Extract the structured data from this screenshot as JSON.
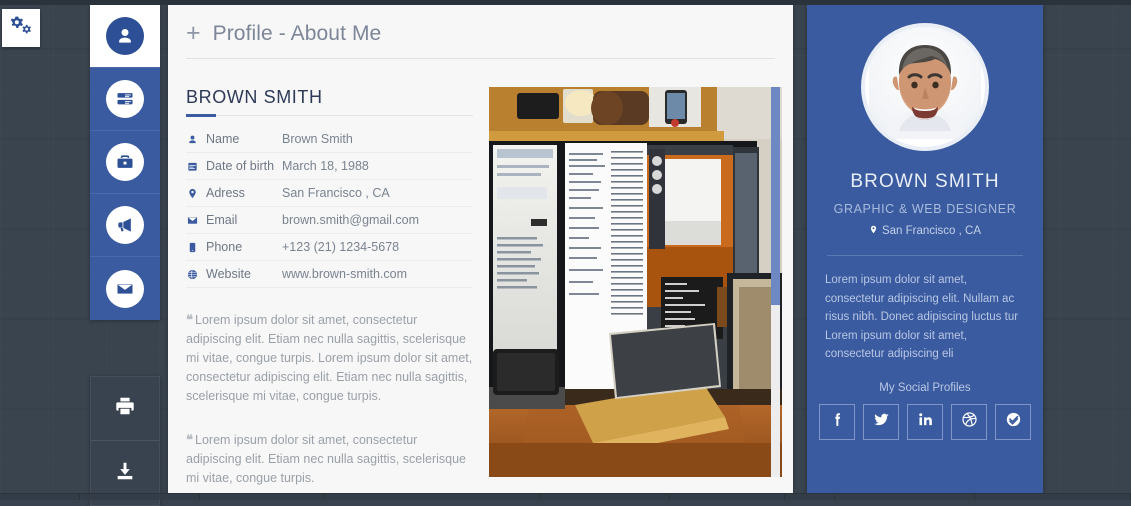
{
  "window": {
    "settings_widget_label": "settings-gears"
  },
  "rail": {
    "primary_items": [
      {
        "name": "profile",
        "icon": "user-icon",
        "active": true
      },
      {
        "name": "resume",
        "icon": "list-icon",
        "active": false
      },
      {
        "name": "portfolio",
        "icon": "briefcase-icon",
        "active": false
      },
      {
        "name": "services",
        "icon": "megaphone-icon",
        "active": false
      },
      {
        "name": "contact",
        "icon": "envelope-icon",
        "active": false
      }
    ],
    "secondary_items": [
      {
        "name": "print",
        "icon": "printer-icon"
      },
      {
        "name": "download",
        "icon": "download-icon"
      }
    ]
  },
  "main": {
    "header": {
      "plus": "+",
      "title": "Profile - About Me"
    },
    "section_title": "BROWN SMITH",
    "info_rows": [
      {
        "icon": "user-icon",
        "label": "Name",
        "value": "Brown Smith"
      },
      {
        "icon": "calendar-icon",
        "label": "Date of birth",
        "value": "March 18, 1988"
      },
      {
        "icon": "pin-icon",
        "label": "Adress",
        "value": "San Francisco , CA"
      },
      {
        "icon": "envelope-icon",
        "label": "Email",
        "value": "brown.smith@gmail.com"
      },
      {
        "icon": "phone-icon",
        "label": "Phone",
        "value": "+123 (21) 1234-5678"
      },
      {
        "icon": "globe-icon",
        "label": "Website",
        "value": "www.brown-smith.com"
      }
    ],
    "quotes": [
      "Lorem ipsum dolor sit amet, consectetur adipiscing elit. Etiam nec nulla sagittis, scelerisque mi vitae, congue turpis. Lorem ipsum dolor sit amet, consectetur adipiscing elit. Etiam nec nulla sagittis, scelerisque mi vitae, congue turpis.",
      "Lorem ipsum dolor sit amet, consectetur adipiscing elit. Etiam nec nulla sagittis, scelerisque mi vitae, congue turpis."
    ],
    "photo_alt": "desk-workspace-photo"
  },
  "card": {
    "avatar_alt": "profile-avatar-photo",
    "name": "BROWN SMITH",
    "role": "GRAPHIC & WEB DESIGNER",
    "location": "San Francisco , CA",
    "bio": "Lorem ipsum dolor sit amet, consectetur adipiscing elit. Nullam ac risus nibh. Donec adipiscing luctus tur Lorem ipsum dolor sit amet, consectetur adipiscing eli",
    "social_title": "My Social Profiles",
    "socials": [
      {
        "name": "facebook",
        "icon": "facebook-icon"
      },
      {
        "name": "twitter",
        "icon": "twitter-icon"
      },
      {
        "name": "linkedin",
        "icon": "linkedin-icon"
      },
      {
        "name": "dribbble",
        "icon": "dribbble-icon"
      },
      {
        "name": "badge",
        "icon": "badge-check-icon"
      }
    ]
  },
  "colors": {
    "brand_blue": "#3a5ba0",
    "desktop_bg": "#3a444f",
    "panel_bg": "#f7f7f7",
    "heading": "#2d3a57",
    "scroll_thumb": "#6e88c4"
  }
}
